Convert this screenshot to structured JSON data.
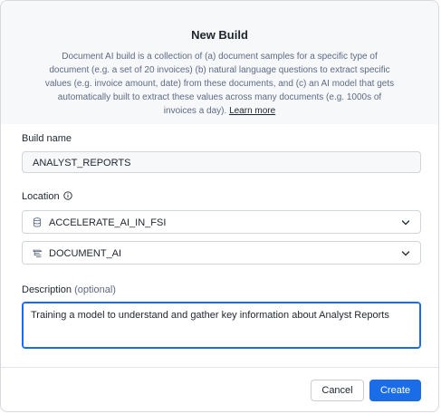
{
  "dialog": {
    "title": "New Build",
    "description": "Document AI build is a collection of (a) document samples for a specific type of document (e.g. a set of 20 invoices) (b) natural language questions to extract specific values (e.g. invoice amount, date) from these documents, and (c) an AI model that gets automatically built to extract these values across many documents (e.g. 1000s of invoices a day).",
    "learn_more": "Learn more"
  },
  "build_name": {
    "label": "Build name",
    "value": "ANALYST_REPORTS"
  },
  "location": {
    "label": "Location",
    "info_icon": "info-circle-icon",
    "database": {
      "value": "ACCELERATE_AI_IN_FSI",
      "icon": "database-icon"
    },
    "schema": {
      "value": "DOCUMENT_AI",
      "icon": "schema-icon"
    }
  },
  "description_field": {
    "label": "Description",
    "optional": "(optional)",
    "value": "Training a model to understand and gather key information about Analyst Reports"
  },
  "footer": {
    "cancel_label": "Cancel",
    "create_label": "Create"
  },
  "colors": {
    "primary": "#1a6ce7",
    "text": "#1e252f",
    "muted": "#5d6a85",
    "header_bg": "#f7f8fa"
  }
}
